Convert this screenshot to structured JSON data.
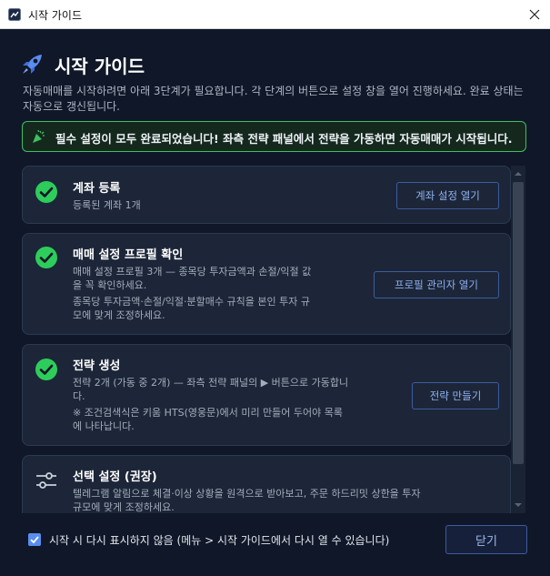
{
  "window": {
    "title": "시작 가이드",
    "app_icon": "app-window-icon",
    "close_icon": "close-icon"
  },
  "header": {
    "title": "시작 가이드",
    "icon": "rocket-icon",
    "description": "자동매매를 시작하려면 아래 3단계가 필요합니다. 각 단계의 버튼으로 설정 창을 열어 진행하세요. 완료 상태는 자동으로 갱신됩니다."
  },
  "banner": {
    "icon": "party-popper-icon",
    "text": "필수 설정이 모두 완료되었습니다! 좌측 전략 패널에서 전략을 가동하면 자동매매가 시작됩니다."
  },
  "steps": [
    {
      "title": "계좌 등록",
      "lines": [
        "등록된 계좌 1개"
      ],
      "button": "계좌 설정 열기",
      "status": "done",
      "icon": "check-circle-icon"
    },
    {
      "title": "매매 설정 프로필 확인",
      "lines": [
        "매매 설정 프로필 3개 — 종목당 투자금액과 손절/익절 값",
        "을 꼭 확인하세요.",
        "종목당 투자금액·손절/익절·분할매수 규칙을 본인 투자 규",
        "모에 맞게 조정하세요."
      ],
      "button": "프로필 관리자 열기",
      "status": "done",
      "icon": "check-circle-icon"
    },
    {
      "title": "전략 생성",
      "lines": [
        "전략 2개 (가동 중 2개) — 좌측 전략 패널의 ▶ 버튼으로 가동합니",
        "다.",
        "※ 조건검색식은 키움 HTS(영웅문)에서 미리 만들어 두어야 목록",
        "에 나타납니다."
      ],
      "button": "전략 만들기",
      "status": "done",
      "icon": "check-circle-icon"
    },
    {
      "title": "선택 설정 (권장)",
      "lines": [
        "텔레그램 알림으로 체결·이상 상황을 원격으로 받아보고, 주문 하드리밋 상한을 투자",
        "규모에 맞게 조정하세요."
      ],
      "status": "optional",
      "icon": "sliders-icon"
    }
  ],
  "footer": {
    "checkbox_checked": true,
    "checkbox_label": "시작 시 다시 표시하지 않음 (메뉴 > 시작 가이드에서 다시 열 수 있습니다)",
    "close_label": "닫기"
  },
  "colors": {
    "background": "#0f1728",
    "card": "#1c2638",
    "accent_blue": "#5b8def",
    "success_green": "#2ecc5a",
    "banner_border": "#3fbf5f"
  }
}
